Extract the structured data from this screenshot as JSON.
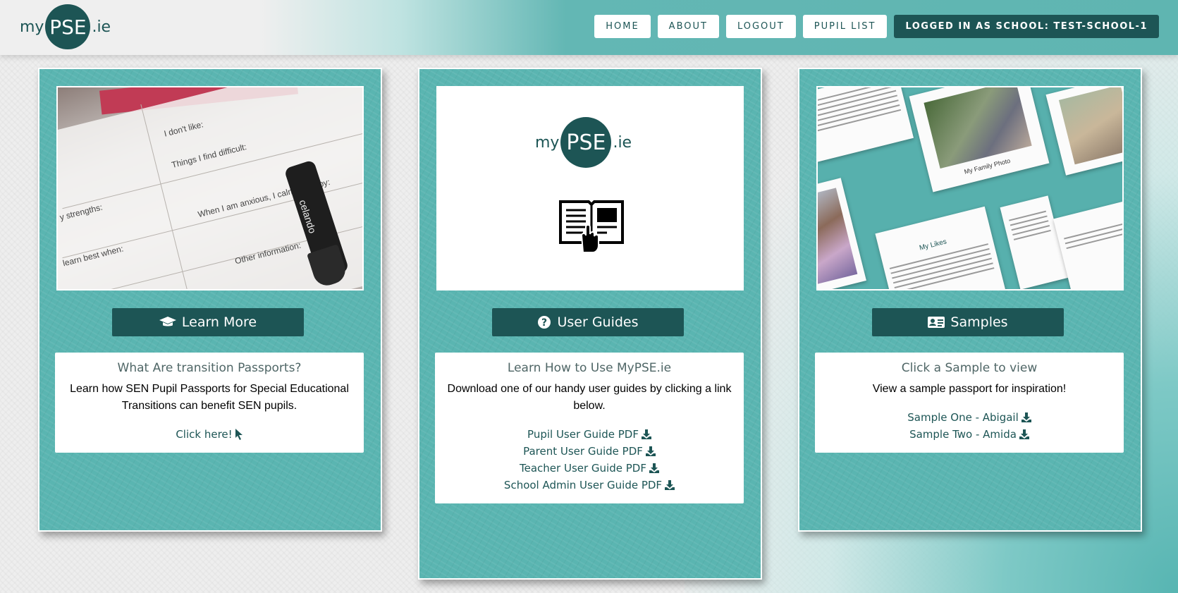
{
  "brand": {
    "prefix": "my",
    "mark": "PSE",
    "suffix": ".ie"
  },
  "nav": {
    "home": "HOME",
    "about": "ABOUT",
    "logout": "LOGOUT",
    "pupil_list": "PUPIL LIST",
    "logged_in": "LOGGED IN AS SCHOOL: TEST-SCHOOL-1"
  },
  "panels": [
    {
      "button": "Learn More",
      "icon": "graduation-cap-icon",
      "heading": "What Are transition Passports?",
      "description": "Learn how SEN Pupil Passports for Special Educational Transitions can benefit SEN pupils.",
      "links": [
        "Click here!"
      ],
      "photo_text": [
        "y strengths:",
        "learn best when:",
        "When I am anxious, I calm down by:",
        "Things I find difficult:",
        "Other information:",
        "I don't like:",
        "celando"
      ]
    },
    {
      "button": "User Guides",
      "icon": "question-circle-icon",
      "heading": "Learn How to Use MyPSE.ie",
      "description": "Download one of our handy user guides by clicking a link below.",
      "links": [
        "Pupil User Guide PDF",
        "Parent User Guide PDF",
        "Teacher User Guide PDF",
        "School Admin User Guide PDF"
      ]
    },
    {
      "button": "Samples",
      "icon": "id-card-icon",
      "heading": "Click a Sample to view",
      "description": "View a sample passport for inspiration!",
      "links": [
        "Sample One - Abigail",
        "Sample Two - Amida"
      ],
      "photo_text": [
        "My Family Photo",
        "My Likes"
      ]
    }
  ],
  "colors": {
    "primary": "#1d5555",
    "panel": "#5ab5b1",
    "white": "#ffffff"
  }
}
